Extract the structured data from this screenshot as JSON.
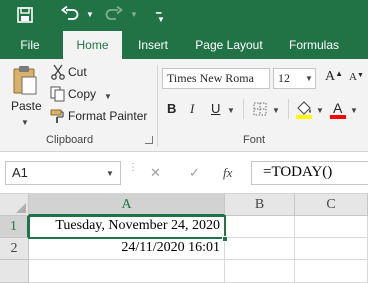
{
  "qat": {
    "save_icon": "save-icon",
    "undo_icon": "undo-icon",
    "redo_icon": "redo-icon",
    "customize_icon": "customize-qat-icon"
  },
  "tabs": [
    {
      "label": "File",
      "active": false
    },
    {
      "label": "Home",
      "active": true
    },
    {
      "label": "Insert",
      "active": false
    },
    {
      "label": "Page Layout",
      "active": false
    },
    {
      "label": "Formulas",
      "active": false
    }
  ],
  "clipboard": {
    "paste_label": "Paste",
    "cut_label": "Cut",
    "copy_label": "Copy",
    "format_painter_label": "Format Painter",
    "group_label": "Clipboard"
  },
  "font": {
    "name": "Times New Roma",
    "size": "12",
    "bold_label": "B",
    "italic_label": "I",
    "underline_label": "U",
    "font_color_label": "A",
    "group_label": "Font",
    "highlight_color": "#ffff00",
    "font_color": "#ff0000"
  },
  "formula_bar": {
    "name_box": "A1",
    "cancel_symbol": "✕",
    "enter_symbol": "✓",
    "fx_label": "fx",
    "formula": "=TODAY()"
  },
  "grid": {
    "columns": [
      "A",
      "B",
      "C"
    ],
    "rows": [
      "1",
      "2"
    ],
    "cells": {
      "A1": "Tuesday, November 24, 2020",
      "A2": "24/11/2020 16:01"
    },
    "selected_cell": "A1"
  },
  "colors": {
    "accent": "#217346",
    "selection": "#217346"
  }
}
